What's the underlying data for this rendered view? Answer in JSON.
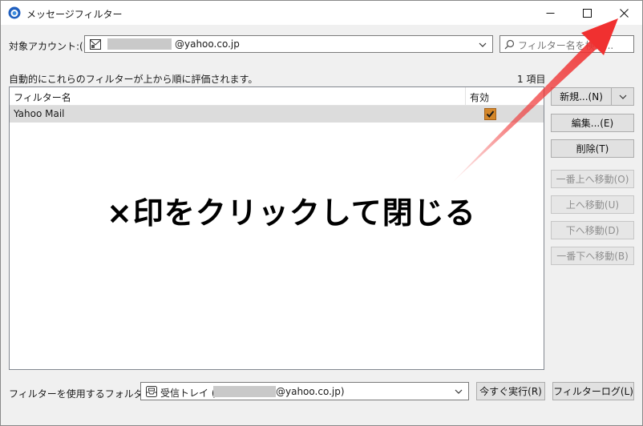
{
  "window": {
    "title": "メッセージフィルター",
    "controls": {
      "minimize": "─",
      "maximize": "☐",
      "close": "✕"
    }
  },
  "account": {
    "label": "対象アカウント:(F)",
    "value_suffix": "@yahoo.co.jp"
  },
  "search": {
    "placeholder": "フィルター名を検索..."
  },
  "info": {
    "description": "自動的にこれらのフィルターが上から順に評価されます。",
    "count": "1 項目"
  },
  "table": {
    "columns": [
      "フィルター名",
      "有効"
    ],
    "rows": [
      {
        "name": "Yahoo Mail",
        "enabled": true
      }
    ]
  },
  "buttons": {
    "new": "新規...(N)",
    "edit": "編集...(E)",
    "delete": "削除(T)",
    "move_top": "一番上へ移動(O)",
    "move_up": "上へ移動(U)",
    "move_down": "下へ移動(D)",
    "move_bottom": "一番下へ移動(B)",
    "run_now": "今すぐ実行(R)",
    "filter_log": "フィルターログ(L)"
  },
  "folder": {
    "label": "フィルターを使用するフォルダー:(C)",
    "prefix": "受信トレイ (",
    "suffix": "@yahoo.co.jp)"
  },
  "annotation": {
    "text": "×印をクリックして閉じる",
    "arrow_color": "#f03030"
  }
}
